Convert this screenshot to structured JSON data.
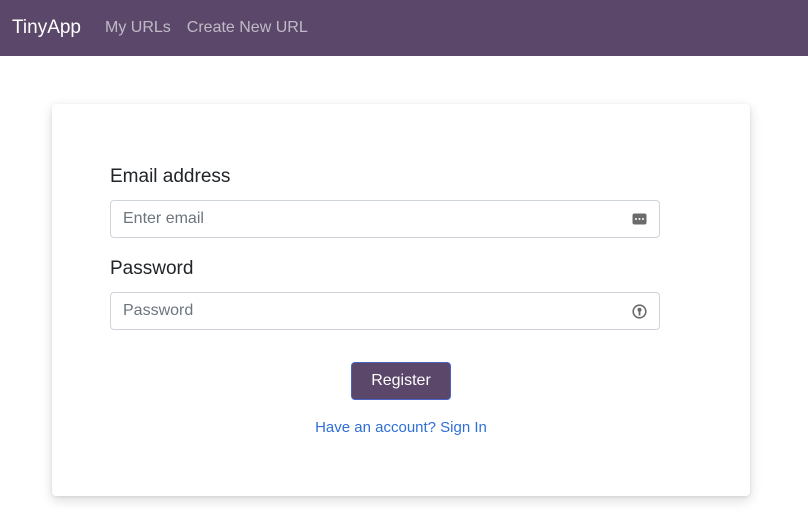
{
  "navbar": {
    "brand": "TinyApp",
    "links": [
      "My URLs",
      "Create New URL"
    ]
  },
  "form": {
    "email": {
      "label": "Email address",
      "placeholder": "Enter email",
      "value": "",
      "icon": "autofill-card-icon"
    },
    "password": {
      "label": "Password",
      "placeholder": "Password",
      "value": "",
      "icon": "password-key-icon"
    },
    "submit_label": "Register",
    "signin_link": "Have an account? Sign In"
  },
  "colors": {
    "navbar_bg": "#5a4769",
    "button_bg": "#5a4769",
    "link": "#2f6fd6"
  }
}
